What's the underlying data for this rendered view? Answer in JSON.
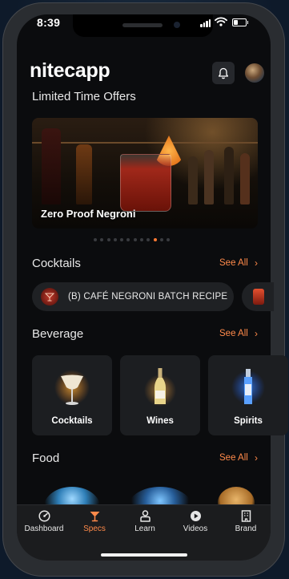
{
  "status": {
    "time": "8:39"
  },
  "header": {
    "brand": "nitecapp"
  },
  "offers": {
    "title": "Limited Time Offers",
    "hero_caption": "Zero Proof Negroni",
    "carousel_count": 12,
    "carousel_active_index": 9
  },
  "cocktails": {
    "title": "Cocktails",
    "see_all": "See All",
    "item_label": "(B) CAFÉ NEGRONI BATCH RECIPE"
  },
  "beverage": {
    "title": "Beverage",
    "see_all": "See All",
    "cards": [
      {
        "label": "Cocktails",
        "icon": "martini-glass-icon"
      },
      {
        "label": "Wines",
        "icon": "wine-bottle-icon"
      },
      {
        "label": "Spirits",
        "icon": "spirit-bottle-icon"
      }
    ]
  },
  "food": {
    "title": "Food",
    "see_all": "See All"
  },
  "tabs": [
    {
      "label": "Dashboard",
      "icon": "dashboard-icon",
      "active": false
    },
    {
      "label": "Specs",
      "icon": "cocktail-glass-icon",
      "active": true
    },
    {
      "label": "Learn",
      "icon": "learn-icon",
      "active": false
    },
    {
      "label": "Videos",
      "icon": "play-icon",
      "active": false
    },
    {
      "label": "Brand",
      "icon": "building-icon",
      "active": false
    }
  ],
  "colors": {
    "accent": "#ff8a4a",
    "background": "#0b0c0e",
    "card": "#1c1e21"
  }
}
